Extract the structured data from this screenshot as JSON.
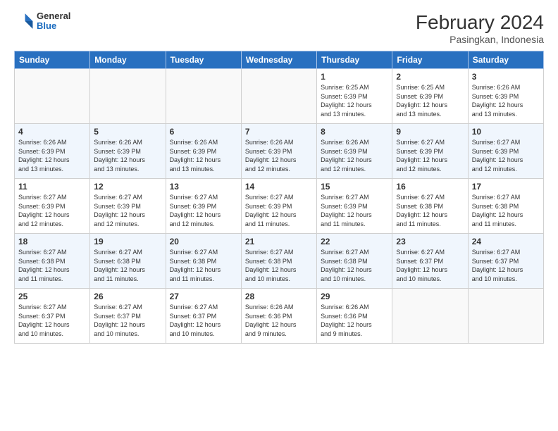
{
  "header": {
    "logo_general": "General",
    "logo_blue": "Blue",
    "main_title": "February 2024",
    "subtitle": "Pasingkan, Indonesia"
  },
  "days_of_week": [
    "Sunday",
    "Monday",
    "Tuesday",
    "Wednesday",
    "Thursday",
    "Friday",
    "Saturday"
  ],
  "weeks": [
    {
      "days": [
        {
          "num": "",
          "info": ""
        },
        {
          "num": "",
          "info": ""
        },
        {
          "num": "",
          "info": ""
        },
        {
          "num": "",
          "info": ""
        },
        {
          "num": "1",
          "info": "Sunrise: 6:25 AM\nSunset: 6:39 PM\nDaylight: 12 hours\nand 13 minutes."
        },
        {
          "num": "2",
          "info": "Sunrise: 6:25 AM\nSunset: 6:39 PM\nDaylight: 12 hours\nand 13 minutes."
        },
        {
          "num": "3",
          "info": "Sunrise: 6:26 AM\nSunset: 6:39 PM\nDaylight: 12 hours\nand 13 minutes."
        }
      ]
    },
    {
      "days": [
        {
          "num": "4",
          "info": "Sunrise: 6:26 AM\nSunset: 6:39 PM\nDaylight: 12 hours\nand 13 minutes."
        },
        {
          "num": "5",
          "info": "Sunrise: 6:26 AM\nSunset: 6:39 PM\nDaylight: 12 hours\nand 13 minutes."
        },
        {
          "num": "6",
          "info": "Sunrise: 6:26 AM\nSunset: 6:39 PM\nDaylight: 12 hours\nand 13 minutes."
        },
        {
          "num": "7",
          "info": "Sunrise: 6:26 AM\nSunset: 6:39 PM\nDaylight: 12 hours\nand 12 minutes."
        },
        {
          "num": "8",
          "info": "Sunrise: 6:26 AM\nSunset: 6:39 PM\nDaylight: 12 hours\nand 12 minutes."
        },
        {
          "num": "9",
          "info": "Sunrise: 6:27 AM\nSunset: 6:39 PM\nDaylight: 12 hours\nand 12 minutes."
        },
        {
          "num": "10",
          "info": "Sunrise: 6:27 AM\nSunset: 6:39 PM\nDaylight: 12 hours\nand 12 minutes."
        }
      ]
    },
    {
      "days": [
        {
          "num": "11",
          "info": "Sunrise: 6:27 AM\nSunset: 6:39 PM\nDaylight: 12 hours\nand 12 minutes."
        },
        {
          "num": "12",
          "info": "Sunrise: 6:27 AM\nSunset: 6:39 PM\nDaylight: 12 hours\nand 12 minutes."
        },
        {
          "num": "13",
          "info": "Sunrise: 6:27 AM\nSunset: 6:39 PM\nDaylight: 12 hours\nand 12 minutes."
        },
        {
          "num": "14",
          "info": "Sunrise: 6:27 AM\nSunset: 6:39 PM\nDaylight: 12 hours\nand 11 minutes."
        },
        {
          "num": "15",
          "info": "Sunrise: 6:27 AM\nSunset: 6:39 PM\nDaylight: 12 hours\nand 11 minutes."
        },
        {
          "num": "16",
          "info": "Sunrise: 6:27 AM\nSunset: 6:38 PM\nDaylight: 12 hours\nand 11 minutes."
        },
        {
          "num": "17",
          "info": "Sunrise: 6:27 AM\nSunset: 6:38 PM\nDaylight: 12 hours\nand 11 minutes."
        }
      ]
    },
    {
      "days": [
        {
          "num": "18",
          "info": "Sunrise: 6:27 AM\nSunset: 6:38 PM\nDaylight: 12 hours\nand 11 minutes."
        },
        {
          "num": "19",
          "info": "Sunrise: 6:27 AM\nSunset: 6:38 PM\nDaylight: 12 hours\nand 11 minutes."
        },
        {
          "num": "20",
          "info": "Sunrise: 6:27 AM\nSunset: 6:38 PM\nDaylight: 12 hours\nand 11 minutes."
        },
        {
          "num": "21",
          "info": "Sunrise: 6:27 AM\nSunset: 6:38 PM\nDaylight: 12 hours\nand 10 minutes."
        },
        {
          "num": "22",
          "info": "Sunrise: 6:27 AM\nSunset: 6:38 PM\nDaylight: 12 hours\nand 10 minutes."
        },
        {
          "num": "23",
          "info": "Sunrise: 6:27 AM\nSunset: 6:37 PM\nDaylight: 12 hours\nand 10 minutes."
        },
        {
          "num": "24",
          "info": "Sunrise: 6:27 AM\nSunset: 6:37 PM\nDaylight: 12 hours\nand 10 minutes."
        }
      ]
    },
    {
      "days": [
        {
          "num": "25",
          "info": "Sunrise: 6:27 AM\nSunset: 6:37 PM\nDaylight: 12 hours\nand 10 minutes."
        },
        {
          "num": "26",
          "info": "Sunrise: 6:27 AM\nSunset: 6:37 PM\nDaylight: 12 hours\nand 10 minutes."
        },
        {
          "num": "27",
          "info": "Sunrise: 6:27 AM\nSunset: 6:37 PM\nDaylight: 12 hours\nand 10 minutes."
        },
        {
          "num": "28",
          "info": "Sunrise: 6:26 AM\nSunset: 6:36 PM\nDaylight: 12 hours\nand 9 minutes."
        },
        {
          "num": "29",
          "info": "Sunrise: 6:26 AM\nSunset: 6:36 PM\nDaylight: 12 hours\nand 9 minutes."
        },
        {
          "num": "",
          "info": ""
        },
        {
          "num": "",
          "info": ""
        }
      ]
    }
  ]
}
